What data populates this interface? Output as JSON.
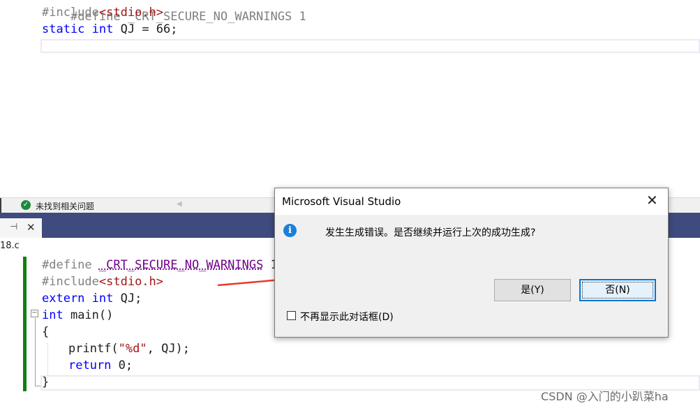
{
  "top_editor": {
    "line0": "#define _CRT_SECURE_NO_WARNINGS 1",
    "line1_pp": "#include",
    "line1_header": "<stdio.h>",
    "line2_kw1": "static",
    "line2_kw2": "int",
    "line2_rest": " QJ = 66;"
  },
  "status_strip": {
    "icon": "check-circle-icon",
    "text": "未找到相关问题"
  },
  "tab_bar": {
    "pin_glyph": "⊣",
    "close_glyph": "✕",
    "file_name": "18.c"
  },
  "bottom_editor": {
    "l1_pp": "#define",
    "l1_macro": "_CRT_SECURE_NO_WARNINGS",
    "l1_val": "1",
    "l2_pp": "#include",
    "l2_header": "<stdio.h>",
    "l3_kw1": "extern",
    "l3_kw2": "int",
    "l3_rest": " QJ;",
    "l4_kw": "int",
    "l4_rest": " main()",
    "l5": "{",
    "l6_fn": "printf(",
    "l6_str": "\"%d\"",
    "l6_rest": ", QJ);",
    "l7_kw": "return",
    "l7_rest": " 0;",
    "l8": "}",
    "collapse_glyph": "−"
  },
  "dialog": {
    "title": "Microsoft Visual Studio",
    "close_glyph": "✕",
    "icon": "info-icon",
    "message": "发生生成错误。是否继续并运行上次的成功生成?",
    "yes_label": "是(Y)",
    "no_label": "否(N)",
    "checkbox_label": "不再显示此对话框(D)",
    "checkbox_checked": false
  },
  "colors": {
    "keyword": "#0000ff",
    "preprocessor": "#808080",
    "string": "#a31515",
    "macro": "#6f008a",
    "tab_bar": "#3f4b7e",
    "change_bar": "#108010",
    "arrow": "#e8392b"
  },
  "watermark": "CSDN @入门的小趴菜ha"
}
